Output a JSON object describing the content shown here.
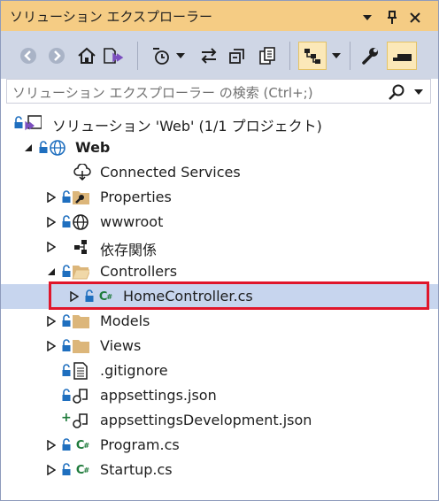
{
  "window": {
    "title": "ソリューション エクスプローラー"
  },
  "search": {
    "placeholder": "ソリューション エクスプローラー の検索 (Ctrl+;)"
  },
  "tree": {
    "solution": "ソリューション 'Web' (1/1 プロジェクト)",
    "project": "Web",
    "items": [
      {
        "label": "Connected Services"
      },
      {
        "label": "Properties"
      },
      {
        "label": "wwwroot"
      },
      {
        "label": "依存関係"
      },
      {
        "label": "Controllers"
      },
      {
        "label": "HomeController.cs"
      },
      {
        "label": "Models"
      },
      {
        "label": "Views"
      },
      {
        "label": ".gitignore"
      },
      {
        "label": "appsettings.json"
      },
      {
        "label": "appsettingsDevelopment.json"
      },
      {
        "label": "Program.cs"
      },
      {
        "label": "Startup.cs"
      }
    ]
  },
  "colors": {
    "titlebar": "#f5cc84",
    "toolbar": "#cfd6e5",
    "selection": "#c7d5ee",
    "highlight": "#e0162b",
    "csharp": "#1d7a3a",
    "folder": "#dcb67a"
  }
}
